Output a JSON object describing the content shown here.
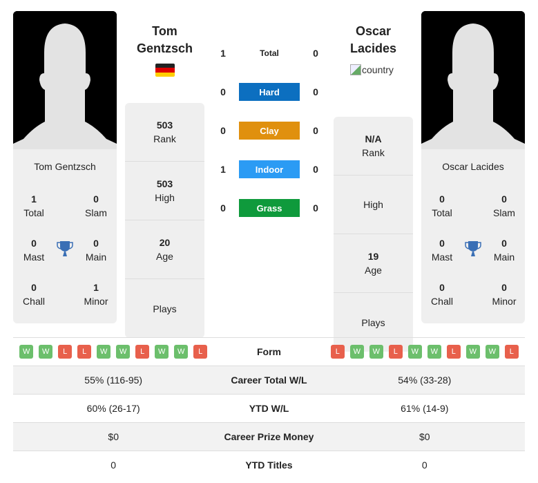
{
  "player1": {
    "name_line1": "Tom",
    "name_line2": "Gentzsch",
    "full_name": "Tom Gentzsch",
    "country_flag": "germany-flag",
    "titles": {
      "total": "1",
      "slam": "0",
      "mast": "0",
      "main": "0",
      "chall": "0",
      "minor": "1"
    },
    "info": {
      "rank": "503",
      "high": "503",
      "age": "20",
      "plays": ""
    },
    "form": [
      "W",
      "W",
      "L",
      "L",
      "W",
      "W",
      "L",
      "W",
      "W",
      "L"
    ],
    "career_total_wl": "55% (116-95)",
    "ytd_wl": "60% (26-17)",
    "career_prize_money": "$0",
    "ytd_titles": "0"
  },
  "player2": {
    "name_line1": "Oscar",
    "name_line2": "Lacides",
    "full_name": "Oscar Lacides",
    "country_alt": "country",
    "titles": {
      "total": "0",
      "slam": "0",
      "mast": "0",
      "main": "0",
      "chall": "0",
      "minor": "0"
    },
    "info": {
      "rank": "N/A",
      "high": "",
      "age": "19",
      "plays": ""
    },
    "form": [
      "L",
      "W",
      "W",
      "L",
      "W",
      "W",
      "L",
      "W",
      "W",
      "L"
    ],
    "career_total_wl": "54% (33-28)",
    "ytd_wl": "61% (14-9)",
    "career_prize_money": "$0",
    "ytd_titles": "0"
  },
  "labels": {
    "total": "Total",
    "slam": "Slam",
    "mast": "Mast",
    "main": "Main",
    "chall": "Chall",
    "minor": "Minor",
    "rank": "Rank",
    "high": "High",
    "age": "Age",
    "plays": "Plays",
    "form": "Form",
    "career_total_wl": "Career Total W/L",
    "ytd_wl": "YTD W/L",
    "career_prize_money": "Career Prize Money",
    "ytd_titles": "YTD Titles"
  },
  "h2h": [
    {
      "label": "Total",
      "p1": "1",
      "p2": "0",
      "color": ""
    },
    {
      "label": "Hard",
      "p1": "0",
      "p2": "0",
      "color": "#0c6fc0"
    },
    {
      "label": "Clay",
      "p1": "0",
      "p2": "0",
      "color": "#e0900e"
    },
    {
      "label": "Indoor",
      "p1": "1",
      "p2": "0",
      "color": "#2b9bf4"
    },
    {
      "label": "Grass",
      "p1": "0",
      "p2": "0",
      "color": "#0f9a3c"
    }
  ],
  "colors": {
    "trophy": "#3a6fb5",
    "win": "#6cbf6c",
    "loss": "#e8604c"
  }
}
